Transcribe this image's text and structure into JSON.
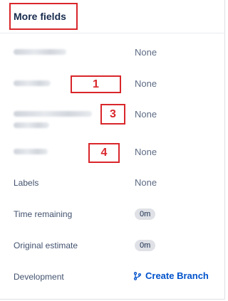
{
  "header": {
    "title": "More fields"
  },
  "fields": [
    {
      "label": "Parent link",
      "value": "None",
      "label_redacted": true
    },
    {
      "label": "Allocation",
      "value": "None",
      "label_redacted": true,
      "callout": "1"
    },
    {
      "label": "Additional Priority Fix Required",
      "value": "None",
      "label_redacted": true,
      "callout": "3"
    },
    {
      "label": "Standard",
      "value": "None",
      "label_redacted": true,
      "callout": "4"
    },
    {
      "label": "Labels",
      "value": "None"
    },
    {
      "label": "Time remaining",
      "value": "0m"
    },
    {
      "label": "Original estimate",
      "value": "0m"
    },
    {
      "label": "Development",
      "value": "Create Branch",
      "icon": "branch-icon"
    }
  ],
  "colors": {
    "annotation": "#d9262b",
    "link": "#0052cc",
    "muted_text": "#5e6c84"
  }
}
